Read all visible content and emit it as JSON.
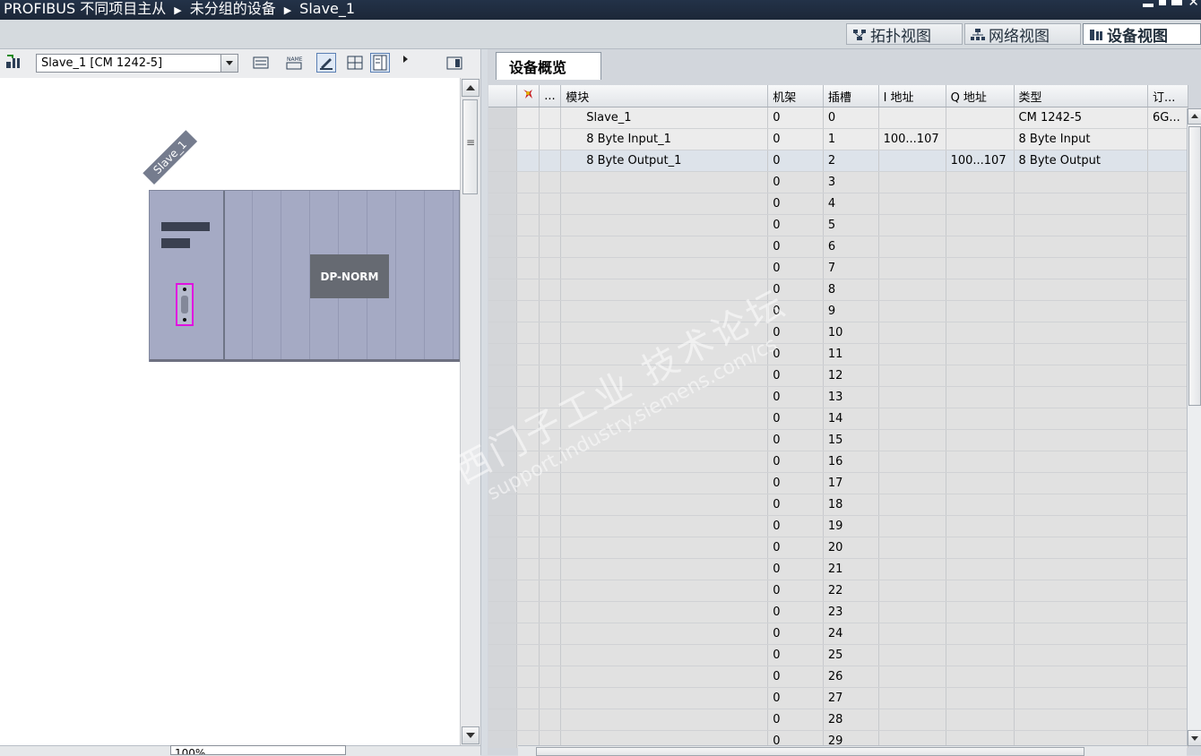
{
  "titlebar": {
    "crumbs": [
      "PROFIBUS 不同项目主从",
      "未分组的设备",
      "Slave_1"
    ]
  },
  "views": {
    "topology": "拓扑视图",
    "network": "网络视图",
    "device": "设备视图"
  },
  "left": {
    "device_select": "Slave_1 [CM 1242-5]",
    "device_label": "Slave_1",
    "module_label": "DP-NORM",
    "zoom": "100%"
  },
  "overview": {
    "tab": "设备概览",
    "columns": [
      "",
      "...",
      "模块",
      "机架",
      "插槽",
      "I 地址",
      "Q 地址",
      "类型",
      "订..."
    ],
    "rows": [
      {
        "module": "Slave_1",
        "rack": "0",
        "slot": "0",
        "iaddr": "",
        "qaddr": "",
        "type": "CM 1242-5",
        "order": "6G..."
      },
      {
        "module": "8 Byte Input_1",
        "rack": "0",
        "slot": "1",
        "iaddr": "100...107",
        "qaddr": "",
        "type": "8 Byte Input",
        "order": ""
      },
      {
        "module": "8 Byte Output_1",
        "rack": "0",
        "slot": "2",
        "iaddr": "",
        "qaddr": "100...107",
        "type": "8 Byte Output",
        "order": ""
      }
    ],
    "empty_rack": "0",
    "empty_slots": [
      "3",
      "4",
      "5",
      "6",
      "7",
      "8",
      "9",
      "10",
      "11",
      "12",
      "13",
      "14",
      "15",
      "16",
      "17",
      "18",
      "19",
      "20",
      "21",
      "22",
      "23",
      "24",
      "25",
      "26",
      "27",
      "28",
      "29"
    ]
  },
  "watermark": {
    "line1": "西门子工业 技术论坛",
    "line2": "support.industry.siemens.com/cs"
  },
  "colors": {
    "title_bg": "#1f2b3d",
    "rail": "#a5aac4",
    "port_highlight": "#e010e0",
    "table_bg": "#e1e1e1"
  }
}
